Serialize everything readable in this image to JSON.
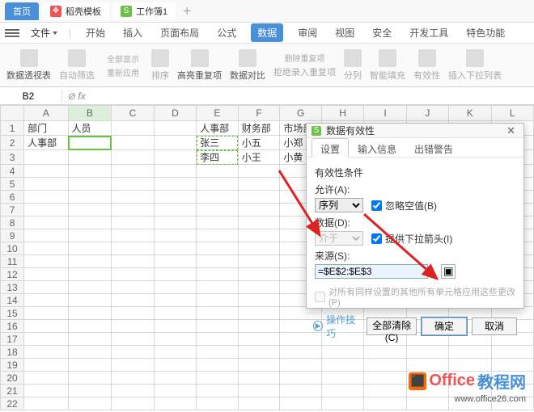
{
  "tabs": {
    "home": "首页",
    "template": "稻壳模板",
    "workbook": "工作簿1"
  },
  "menu": {
    "file": "文件",
    "start": "开始",
    "insert": "插入",
    "layout": "页面布局",
    "formula": "公式",
    "data": "数据",
    "review": "审阅",
    "view": "视图",
    "security": "安全",
    "dev": "开发工具",
    "special": "特色功能"
  },
  "ribbon": {
    "pivot": "数据透视表",
    "autofilter": "自动筛选",
    "reapply": "重新应用",
    "showall": "全部显示",
    "sort": "排序",
    "highlight": "高亮重复项",
    "compare": "数据对比",
    "reject": "拒绝录入重复项",
    "removedup": "删除重复项",
    "split": "分列",
    "fill": "智能填充",
    "validity": "有效性",
    "insertlist": "插入下拉列表"
  },
  "namebox": "B2",
  "cols": [
    "A",
    "B",
    "C",
    "D",
    "E",
    "F",
    "G",
    "H",
    "I",
    "J",
    "K",
    "L"
  ],
  "rows": [
    "1",
    "2",
    "3",
    "4",
    "5",
    "6",
    "7",
    "8",
    "9",
    "10",
    "11",
    "12",
    "13",
    "14",
    "15",
    "16",
    "17",
    "18",
    "19",
    "20",
    "21",
    "22"
  ],
  "cells": {
    "A1": "部门",
    "B1": "人员",
    "A2": "人事部",
    "E1": "人事部",
    "F1": "财务部",
    "G1": "市场部",
    "E2": "张三",
    "F2": "小五",
    "G2": "小郑",
    "E3": "李四",
    "F3": "小王",
    "G3": "小黄"
  },
  "dialog": {
    "title": "数据有效性",
    "tabs": {
      "settings": "设置",
      "input": "输入信息",
      "error": "出错警告"
    },
    "criteria_label": "有效性条件",
    "allow_label": "允许(A):",
    "allow_value": "序列",
    "ignore_blank": "忽略空值(B)",
    "dropdown": "提供下拉箭头(I)",
    "data_label": "数据(D):",
    "data_value": "介于",
    "source_label": "来源(S):",
    "source_value": "=$E$2:$E$3",
    "apply_label": "对所有同样设置的其他所有单元格应用这些更改(P)",
    "tips": "操作技巧",
    "clear": "全部清除(C)",
    "ok": "确定",
    "cancel": "取消"
  },
  "watermark": {
    "brand_prefix": "Office",
    "brand_suffix": "教程网",
    "url": "www.office26.com"
  }
}
